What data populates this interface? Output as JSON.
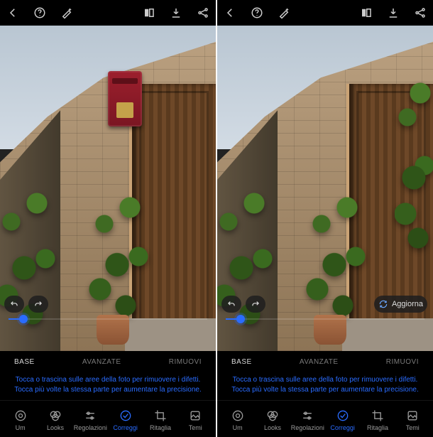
{
  "topbar": {
    "back": "back-icon",
    "help": "help-icon",
    "wand": "magic-wand-icon",
    "compare": "compare-icon",
    "download": "download-icon",
    "share": "share-icon"
  },
  "tabs": {
    "base": "BASE",
    "avanzate": "AVANZATE",
    "rimuovi": "RIMUOVI"
  },
  "hint": {
    "line1": "Tocca o trascina sulle aree della foto per rimuovere i difetti.",
    "line2": "Tocca più volte la stessa parte per aumentare la precisione."
  },
  "refresh_label": "Aggiorna",
  "bottom": {
    "um": "Um",
    "looks": "Looks",
    "regolazioni": "Regolazioni",
    "correggi": "Correggi",
    "ritaglia": "Ritaglia",
    "temi": "Temi"
  }
}
